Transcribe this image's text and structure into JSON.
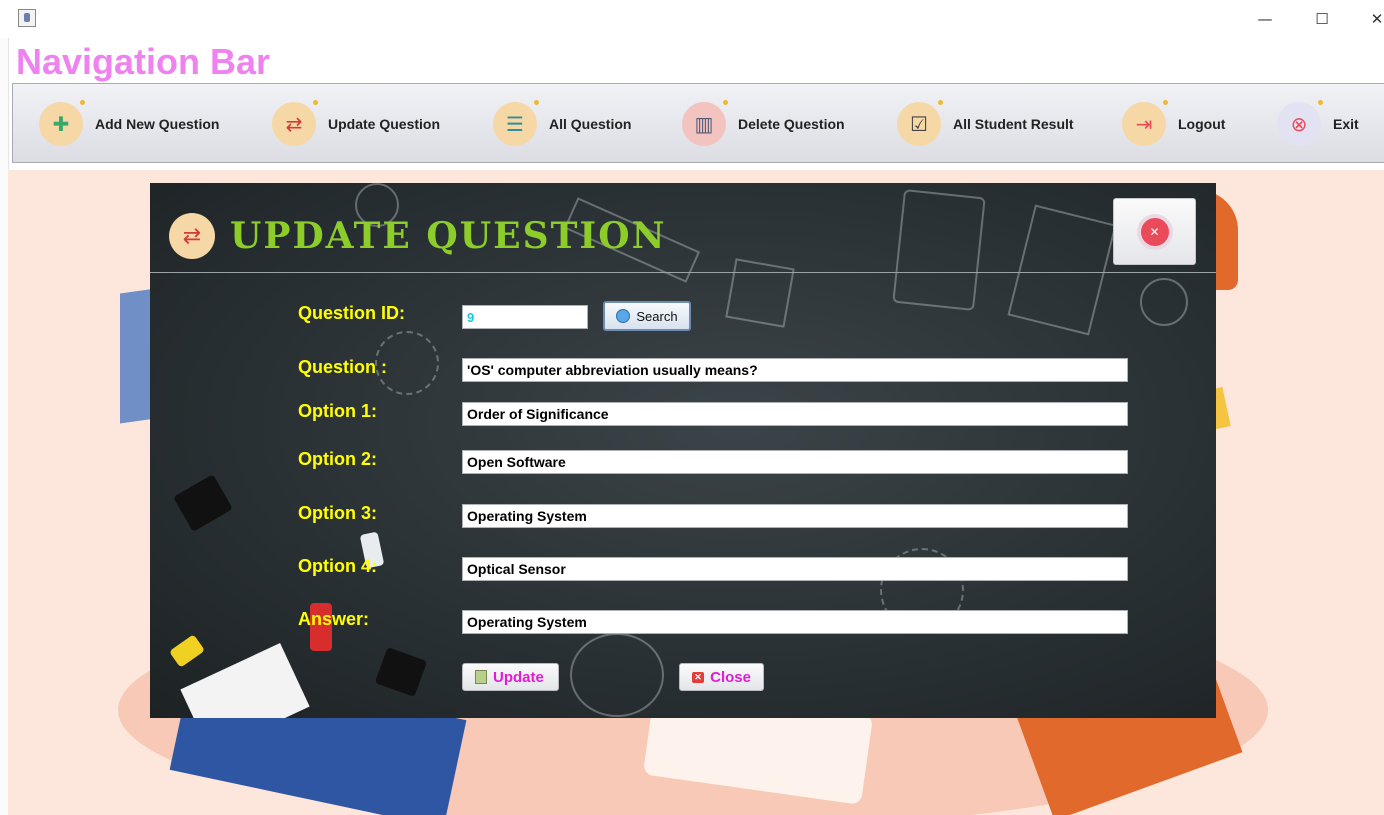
{
  "window": {
    "minimize": "—",
    "maximize": "☐",
    "close": "✕"
  },
  "app": {
    "nav_title": "Navigation Bar"
  },
  "nav": {
    "items": [
      {
        "label": "Add New Question",
        "icon": "add-question-icon",
        "glyph": "✚",
        "bg": "#f6d8a6",
        "fg": "#3aa86b"
      },
      {
        "label": "Update Question",
        "icon": "update-arrows-icon",
        "glyph": "⇄",
        "bg": "#f6d8a6",
        "fg": "#d23b3b"
      },
      {
        "label": "All Question",
        "icon": "list-icon",
        "glyph": "☰",
        "bg": "#f6d8a6",
        "fg": "#2e8f9a"
      },
      {
        "label": "Delete Question",
        "icon": "trash-icon",
        "glyph": "🗑",
        "bg": "#f3c4bf",
        "fg": "#555c78"
      },
      {
        "label": "All Student Result",
        "icon": "checklist-icon",
        "glyph": "☑",
        "bg": "#f6d8a6",
        "fg": "#444"
      },
      {
        "label": "Logout",
        "icon": "logout-icon",
        "glyph": "⇥",
        "bg": "#f6d8a6",
        "fg": "#e94b5b"
      },
      {
        "label": "Exit",
        "icon": "exit-icon",
        "glyph": "⊗",
        "bg": "#e3e2f2",
        "fg": "#e94b5b"
      }
    ]
  },
  "form": {
    "title": "UPDATE QUESTION",
    "close_glyph": "✕",
    "labels": {
      "question_id": "Question ID:",
      "question": "Question :",
      "option1": "Option 1:",
      "option2": "Option 2:",
      "option3": "Option 3:",
      "option4": "Option 4:",
      "answer": "Answer:"
    },
    "values": {
      "question_id": "9",
      "question": "'OS' computer abbreviation usually means?",
      "option1": "Order of Significance",
      "option2": "Open Software",
      "option3": "Operating System",
      "option4": "Optical Sensor",
      "answer": "Operating System"
    },
    "buttons": {
      "search": "Search",
      "update": "Update",
      "close": "Close"
    },
    "colors": {
      "title": "#8ccd2a",
      "labels": "#ffff00",
      "buttons": "#e11cd6",
      "id_text": "#18c8e0"
    }
  }
}
